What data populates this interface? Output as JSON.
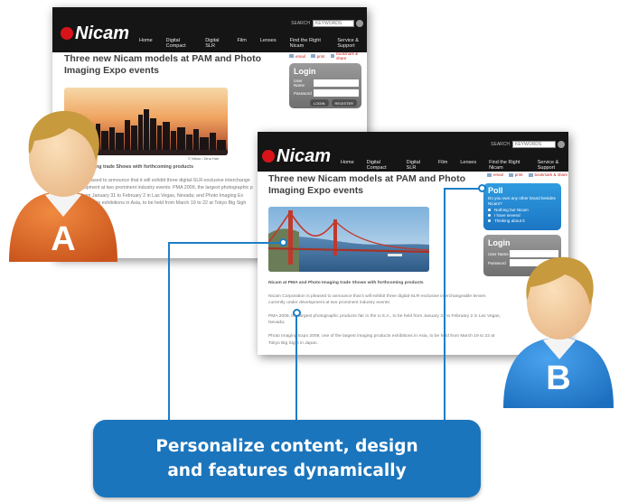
{
  "site_a": {
    "logo": "Nicam",
    "search_label": "SEARCH",
    "search_placeholder": "KEYWORDS",
    "nav": [
      "Home",
      "Digital Compact",
      "Digital SLR",
      "Film",
      "Lenses",
      "Find the Right Nicam",
      "Service & Support"
    ],
    "title_line1": "Three new Nicam models at PAM and Photo",
    "title_line2": "Imaging Expo events",
    "tools": [
      "email",
      "print",
      "bookmark & share"
    ],
    "login": {
      "title": "Login",
      "username_label": "User Name",
      "password_label": "Password",
      "login_button": "LOGIN",
      "register_button": "REGISTER"
    },
    "caption": "© Nikon / Dina Hari",
    "subhead": "d Photo Imaging trade Shows with forthcoming products",
    "lines": [
      "oration is pleased to announce that it will exhibit three digital-SLR-exclusive interchange",
      "der development at two prominent industry events: PMA 2009, the largest photographic p",
      "be held from January 31 to February 2 in Las Vegas, Nevada; and Photo Imaging Ex",
      "imaging products exhibitions in Asia, to be held from March 19 to 22 at Tokyo Big Sigh"
    ]
  },
  "site_b": {
    "logo": "Nicam",
    "search_label": "SEARCH",
    "search_placeholder": "KEYWORDS",
    "nav": [
      "Home",
      "Digital Compact",
      "Digital SLR",
      "Film",
      "Lenses",
      "Find the Right Nicam",
      "Service & Support"
    ],
    "title_line1": "Three new Nicam models at PAM and Photo",
    "title_line2": "Imaging Expo events",
    "tools": [
      "email",
      "print",
      "bookmark & share"
    ],
    "poll": {
      "title": "Poll",
      "question": "Do you own any other brand besides Nicam?",
      "options": [
        "Nothing but Nicam",
        "I have several",
        "Thinking about it"
      ]
    },
    "login": {
      "title": "Login",
      "username_label": "User Name",
      "password_label": "Password"
    },
    "subhead": "Nicam at PMA and Photo Imaging trade Shows with forthcoming products",
    "p1": "Nicam Corporation is pleased to announce that it will exhibit three digital-SLR-exclusive interchangeable lenses currently under development at two prominent industry events:",
    "p2": "PMA 2009, the largest photographic products fair in the U.S.A., to be held from January 31 to February 2 in Las Vegas, Nevada;",
    "p3": "Photo Imaging Expo 2009, one of the largest imaging products exhibitions in Asia, to be held from March 19 to 22 at Tokyo Big Sight in Japan."
  },
  "avatars": {
    "a": "A",
    "b": "B"
  },
  "callout": {
    "line1": "Personalize content, design",
    "line2": "and features dynamically"
  },
  "colors": {
    "accent_blue": "#1b75bc",
    "brand_red": "#d8141a",
    "avatar_a_shirt": "#e06a25",
    "avatar_b_shirt": "#2a86d6"
  }
}
